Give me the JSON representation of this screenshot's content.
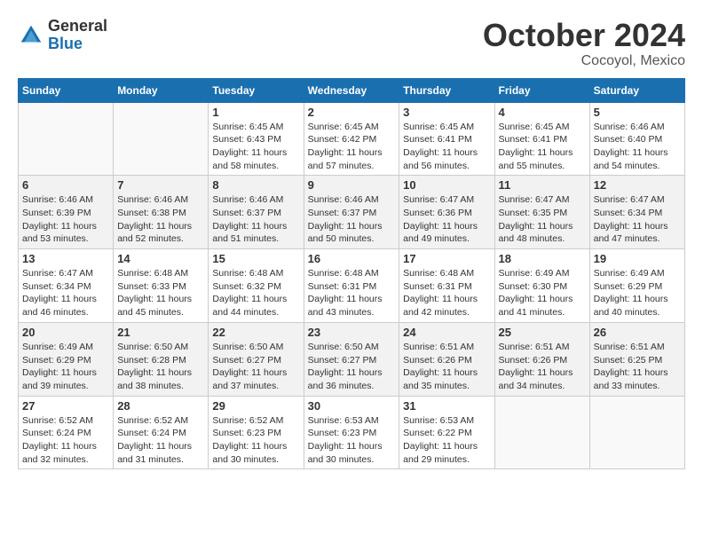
{
  "header": {
    "logo": {
      "general": "General",
      "blue": "Blue"
    },
    "month": "October 2024",
    "location": "Cocoyol, Mexico"
  },
  "weekdays": [
    "Sunday",
    "Monday",
    "Tuesday",
    "Wednesday",
    "Thursday",
    "Friday",
    "Saturday"
  ],
  "weeks": [
    [
      {
        "day": "",
        "info": ""
      },
      {
        "day": "",
        "info": ""
      },
      {
        "day": "1",
        "info": "Sunrise: 6:45 AM\nSunset: 6:43 PM\nDaylight: 11 hours and 58 minutes."
      },
      {
        "day": "2",
        "info": "Sunrise: 6:45 AM\nSunset: 6:42 PM\nDaylight: 11 hours and 57 minutes."
      },
      {
        "day": "3",
        "info": "Sunrise: 6:45 AM\nSunset: 6:41 PM\nDaylight: 11 hours and 56 minutes."
      },
      {
        "day": "4",
        "info": "Sunrise: 6:45 AM\nSunset: 6:41 PM\nDaylight: 11 hours and 55 minutes."
      },
      {
        "day": "5",
        "info": "Sunrise: 6:46 AM\nSunset: 6:40 PM\nDaylight: 11 hours and 54 minutes."
      }
    ],
    [
      {
        "day": "6",
        "info": "Sunrise: 6:46 AM\nSunset: 6:39 PM\nDaylight: 11 hours and 53 minutes."
      },
      {
        "day": "7",
        "info": "Sunrise: 6:46 AM\nSunset: 6:38 PM\nDaylight: 11 hours and 52 minutes."
      },
      {
        "day": "8",
        "info": "Sunrise: 6:46 AM\nSunset: 6:37 PM\nDaylight: 11 hours and 51 minutes."
      },
      {
        "day": "9",
        "info": "Sunrise: 6:46 AM\nSunset: 6:37 PM\nDaylight: 11 hours and 50 minutes."
      },
      {
        "day": "10",
        "info": "Sunrise: 6:47 AM\nSunset: 6:36 PM\nDaylight: 11 hours and 49 minutes."
      },
      {
        "day": "11",
        "info": "Sunrise: 6:47 AM\nSunset: 6:35 PM\nDaylight: 11 hours and 48 minutes."
      },
      {
        "day": "12",
        "info": "Sunrise: 6:47 AM\nSunset: 6:34 PM\nDaylight: 11 hours and 47 minutes."
      }
    ],
    [
      {
        "day": "13",
        "info": "Sunrise: 6:47 AM\nSunset: 6:34 PM\nDaylight: 11 hours and 46 minutes."
      },
      {
        "day": "14",
        "info": "Sunrise: 6:48 AM\nSunset: 6:33 PM\nDaylight: 11 hours and 45 minutes."
      },
      {
        "day": "15",
        "info": "Sunrise: 6:48 AM\nSunset: 6:32 PM\nDaylight: 11 hours and 44 minutes."
      },
      {
        "day": "16",
        "info": "Sunrise: 6:48 AM\nSunset: 6:31 PM\nDaylight: 11 hours and 43 minutes."
      },
      {
        "day": "17",
        "info": "Sunrise: 6:48 AM\nSunset: 6:31 PM\nDaylight: 11 hours and 42 minutes."
      },
      {
        "day": "18",
        "info": "Sunrise: 6:49 AM\nSunset: 6:30 PM\nDaylight: 11 hours and 41 minutes."
      },
      {
        "day": "19",
        "info": "Sunrise: 6:49 AM\nSunset: 6:29 PM\nDaylight: 11 hours and 40 minutes."
      }
    ],
    [
      {
        "day": "20",
        "info": "Sunrise: 6:49 AM\nSunset: 6:29 PM\nDaylight: 11 hours and 39 minutes."
      },
      {
        "day": "21",
        "info": "Sunrise: 6:50 AM\nSunset: 6:28 PM\nDaylight: 11 hours and 38 minutes."
      },
      {
        "day": "22",
        "info": "Sunrise: 6:50 AM\nSunset: 6:27 PM\nDaylight: 11 hours and 37 minutes."
      },
      {
        "day": "23",
        "info": "Sunrise: 6:50 AM\nSunset: 6:27 PM\nDaylight: 11 hours and 36 minutes."
      },
      {
        "day": "24",
        "info": "Sunrise: 6:51 AM\nSunset: 6:26 PM\nDaylight: 11 hours and 35 minutes."
      },
      {
        "day": "25",
        "info": "Sunrise: 6:51 AM\nSunset: 6:26 PM\nDaylight: 11 hours and 34 minutes."
      },
      {
        "day": "26",
        "info": "Sunrise: 6:51 AM\nSunset: 6:25 PM\nDaylight: 11 hours and 33 minutes."
      }
    ],
    [
      {
        "day": "27",
        "info": "Sunrise: 6:52 AM\nSunset: 6:24 PM\nDaylight: 11 hours and 32 minutes."
      },
      {
        "day": "28",
        "info": "Sunrise: 6:52 AM\nSunset: 6:24 PM\nDaylight: 11 hours and 31 minutes."
      },
      {
        "day": "29",
        "info": "Sunrise: 6:52 AM\nSunset: 6:23 PM\nDaylight: 11 hours and 30 minutes."
      },
      {
        "day": "30",
        "info": "Sunrise: 6:53 AM\nSunset: 6:23 PM\nDaylight: 11 hours and 30 minutes."
      },
      {
        "day": "31",
        "info": "Sunrise: 6:53 AM\nSunset: 6:22 PM\nDaylight: 11 hours and 29 minutes."
      },
      {
        "day": "",
        "info": ""
      },
      {
        "day": "",
        "info": ""
      }
    ]
  ]
}
